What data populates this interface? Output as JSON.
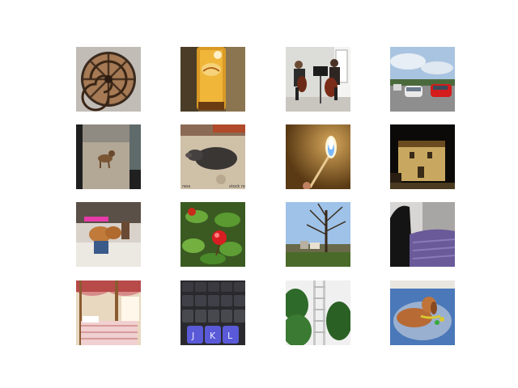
{
  "grid": {
    "rows": 4,
    "columns": 4,
    "tiles": [
      {
        "subject": "nautilus-shell-manhole-cover"
      },
      {
        "subject": "sunscreen-tube"
      },
      {
        "subject": "cello-players"
      },
      {
        "subject": "parking-lot-cars"
      },
      {
        "subject": "dog-on-beach"
      },
      {
        "subject": "pig-lying-down",
        "caption_left": "ress",
        "caption_right": "stock ro"
      },
      {
        "subject": "lit-match-flame"
      },
      {
        "subject": "old-stone-building-night"
      },
      {
        "subject": "small-dog-in-jeans"
      },
      {
        "subject": "rose-hip-leaves"
      },
      {
        "subject": "bare-tree-park"
      },
      {
        "subject": "shoe-and-purple-sock"
      },
      {
        "subject": "four-poster-bed"
      },
      {
        "subject": "keyboard-keys",
        "keys": [
          "J",
          "K",
          "L"
        ]
      },
      {
        "subject": "ladder-tower-trees"
      },
      {
        "subject": "dog-on-blanket"
      }
    ]
  }
}
